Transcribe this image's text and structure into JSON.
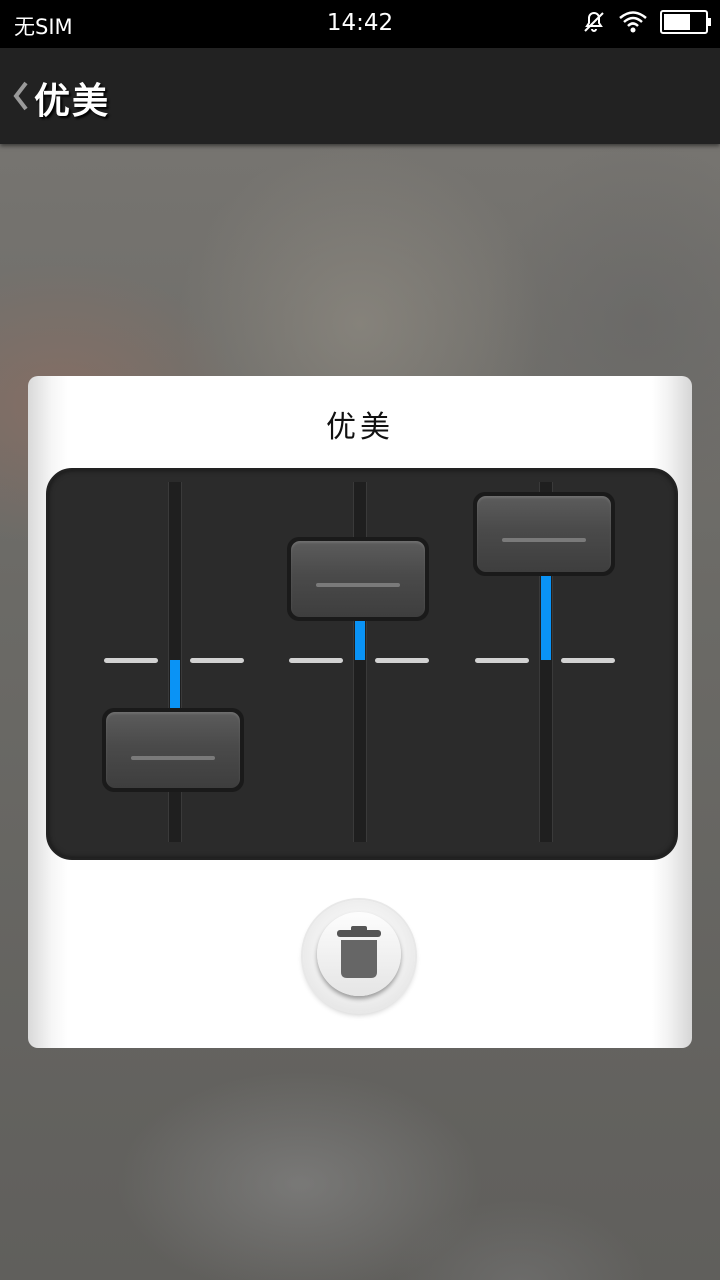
{
  "status_bar": {
    "carrier": "无SIM",
    "time": "14:42",
    "icons": [
      "mute-icon",
      "wifi-icon",
      "battery-icon"
    ]
  },
  "action_bar": {
    "back_icon": "chevron-left-icon",
    "title": "优美"
  },
  "dialog": {
    "title": "优美",
    "sliders": [
      {
        "name": "slider-1",
        "level": -0.5
      },
      {
        "name": "slider-2",
        "level": 0.45
      },
      {
        "name": "slider-3",
        "level": 0.7
      }
    ],
    "delete_icon": "trash-icon"
  },
  "colors": {
    "accent": "#0a93f5",
    "panel": "#2b2b2b",
    "action_bar": "#222222"
  }
}
